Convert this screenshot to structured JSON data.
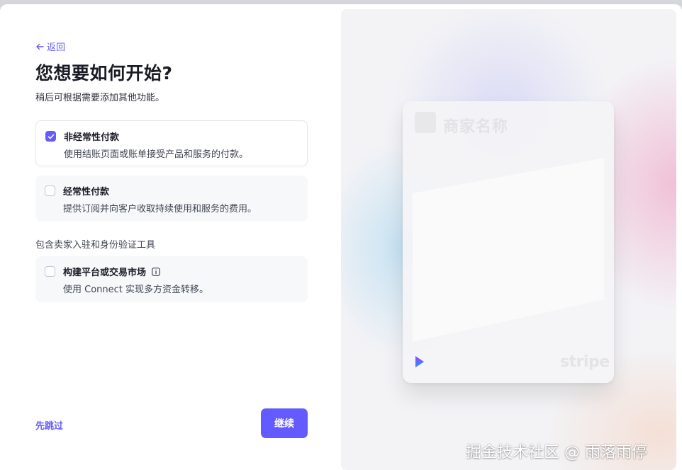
{
  "header": {
    "back_label": "返回",
    "title": "您想要如何开始?",
    "subtitle": "稍后可根据需要添加其他功能。"
  },
  "options": [
    {
      "title": "非经常性付款",
      "description": "使用结账页面或账单接受产品和服务的付款。",
      "checked": true
    },
    {
      "title": "经常性付款",
      "description": "提供订阅并向客户收取持续使用和服务的费用。",
      "checked": false
    }
  ],
  "section": {
    "label": "包含卖家入驻和身份验证工具",
    "option": {
      "title": "构建平台或交易市场",
      "description": "使用 Connect 实现多方资金转移。",
      "checked": false,
      "icon": "info-icon"
    }
  },
  "footer": {
    "skip_label": "先跳过",
    "continue_label": "继续"
  },
  "preview_card": {
    "merchant_name": "商家名称",
    "brand": "stripe"
  },
  "watermark": "掘金技术社区 @ 雨落雨停",
  "colors": {
    "accent": "#635bff",
    "text": "#30313d",
    "option_bg": "#f6f8fa"
  }
}
